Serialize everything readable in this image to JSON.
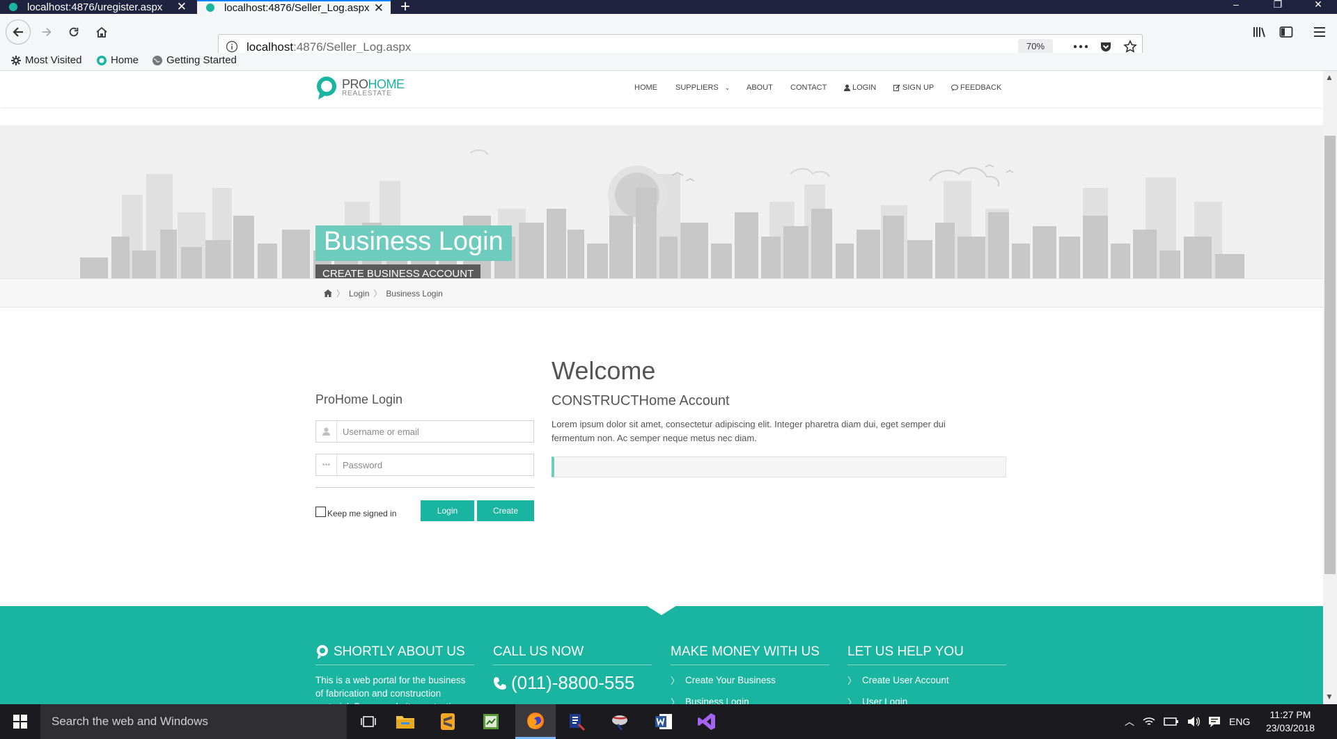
{
  "browser": {
    "tabs": [
      {
        "title": "localhost:4876/uregister.aspx"
      },
      {
        "title": "localhost:4876/Seller_Log.aspx"
      }
    ],
    "url_host": "localhost",
    "url_path": ":4876/Seller_Log.aspx",
    "zoom": "70%",
    "bookmarks": [
      "Most Visited",
      "Home",
      "Getting Started"
    ]
  },
  "site": {
    "logo_pro": "PRO",
    "logo_home": "HOME",
    "logo_sub": "REALESTATE",
    "menu": [
      "HOME",
      "SUPPLIERS",
      "ABOUT",
      "CONTACT",
      "LOGIN",
      "SIGN UP",
      "FEEDBACK"
    ]
  },
  "hero": {
    "title": "Business Login",
    "subtitle": "CREATE BUSINESS ACCOUNT"
  },
  "breadcrumb": [
    "Login",
    "Business Login"
  ],
  "login": {
    "title": "ProHome Login",
    "username_placeholder": "Username or email",
    "password_placeholder": "Password",
    "keep_signed_in": "Keep me signed in",
    "login_btn": "Login",
    "create_btn": "Create"
  },
  "welcome": {
    "heading": "Welcome",
    "subheading": "CONSTRUCTHome Account",
    "body": "Lorem ipsum dolor sit amet, consectetur adipiscing elit. Integer pharetra diam dui, eget semper dui fermentum non. Ac semper neque metus nec diam."
  },
  "footer": {
    "about_title": "SHORTLY ABOUT US",
    "about_text": "This is a web portal for the business of fabrication and construction material. By our website contacting",
    "call_title": "CALL US NOW",
    "phone": "(011)-8800-555",
    "money_title": "MAKE MONEY WITH US",
    "money_links": [
      "Create Your Business",
      "Business Login"
    ],
    "help_title": "LET US HELP YOU",
    "help_links": [
      "Create User Account",
      "User Login"
    ]
  },
  "taskbar": {
    "search_placeholder": "Search the web and Windows",
    "lang": "ENG",
    "time": "11:27 PM",
    "date": "23/03/2018"
  },
  "colors": {
    "accent": "#1ab5a0",
    "hero_title_bg": "#6dccbd",
    "tabbar": "#202340"
  }
}
